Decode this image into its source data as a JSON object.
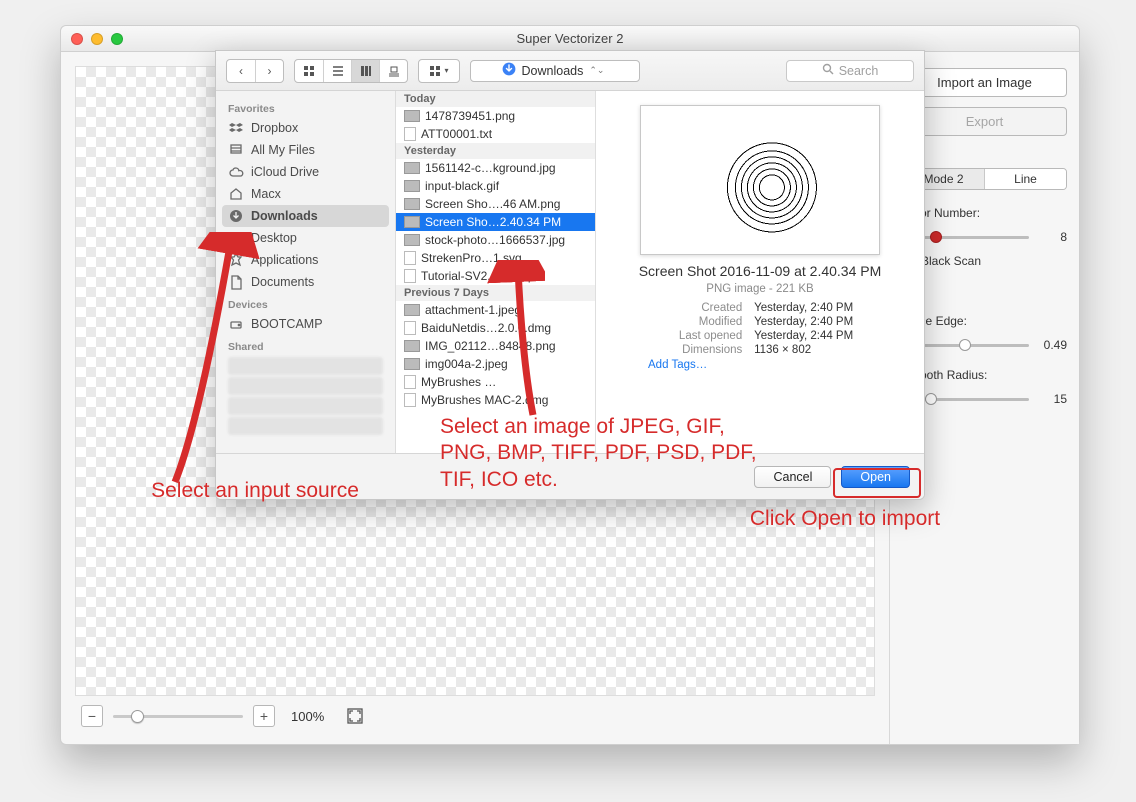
{
  "window": {
    "title": "Super Vectorizer 2"
  },
  "side_panel": {
    "import_btn": "Import an Image",
    "export_btn": "Export",
    "mode_tabs": [
      "Mode 2",
      "Line"
    ],
    "active_mode_index": 0,
    "color_number_label": "Color Number:",
    "color_number_value": "8",
    "black_scan_label": "Black Scan",
    "edge_label": "Trace Edge:",
    "edge_value": "0.49",
    "radius_label": "Smooth Radius:",
    "radius_value": "15"
  },
  "bottom": {
    "zoom_pct": "100%"
  },
  "sheet": {
    "location": "Downloads",
    "search_placeholder": "Search",
    "sidebar": {
      "sections": {
        "favorites_label": "Favorites",
        "devices_label": "Devices",
        "shared_label": "Shared"
      },
      "favorites": [
        "Dropbox",
        "All My Files",
        "iCloud Drive",
        "Macx",
        "Downloads",
        "Desktop",
        "Applications",
        "Documents"
      ],
      "selected_favorite_index": 4,
      "devices": [
        "BOOTCAMP"
      ]
    },
    "column": {
      "groups": [
        {
          "label": "Today",
          "files": [
            "1478739451.png",
            "ATT00001.txt"
          ]
        },
        {
          "label": "Yesterday",
          "files": [
            "1561142-c…kground.jpg",
            "input-black.gif",
            "Screen Sho….46 AM.png",
            "Screen Sho…2.40.34 PM",
            "stock-photo…1666537.jpg",
            "StrekenPro…1.svg",
            "Tutorial-SV2.docx.zip"
          ],
          "selected_index": 3
        },
        {
          "label": "Previous 7 Days",
          "files": [
            "attachment-1.jpeg",
            "BaiduNetdis…2.0.0.dmg",
            "IMG_02112…84848.png",
            "img004a-2.jpeg",
            "MyBrushes …",
            "MyBrushes MAC-2.dmg"
          ]
        }
      ]
    },
    "preview": {
      "title": "Screen Shot 2016-11-09 at 2.40.34 PM",
      "subtitle": "PNG image - 221 KB",
      "meta": {
        "Created": "Yesterday, 2:40 PM",
        "Modified": "Yesterday, 2:40 PM",
        "Last opened": "Yesterday, 2:44 PM",
        "Dimensions": "1136 × 802"
      },
      "add_tags": "Add Tags…"
    },
    "footer": {
      "cancel": "Cancel",
      "open": "Open"
    }
  },
  "annotations": {
    "left": "Select an input source",
    "center": "Select an image of JPEG, GIF, PNG, BMP, TIFF, PDF, PSD, PDF, TIF, ICO etc.",
    "right": "Click Open to import"
  }
}
